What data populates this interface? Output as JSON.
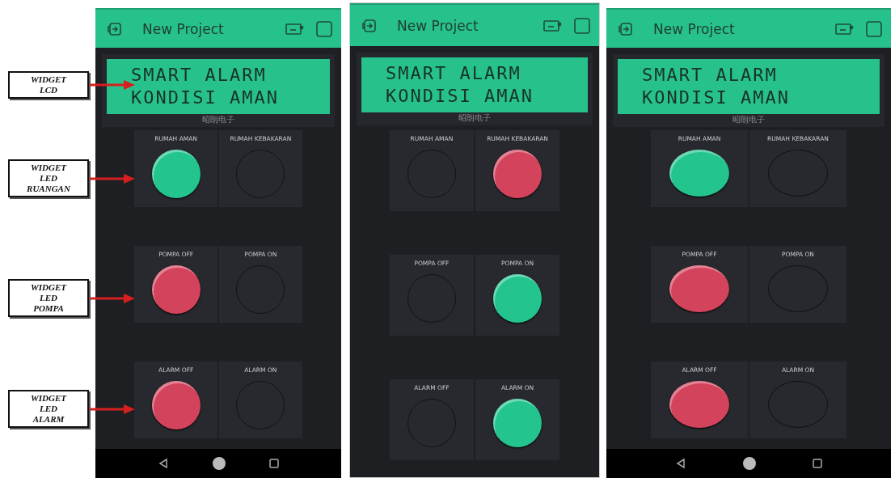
{
  "annotations": [
    {
      "text": "WIDGET\nLCD"
    },
    {
      "text": "WIDGET\nLED\nRUANGAN"
    },
    {
      "text": "WIDGET\nLED\nPOMPA"
    },
    {
      "text": "WIDGET\nLED\nALARM"
    }
  ],
  "phones": [
    {
      "title": "New Project",
      "lcd": [
        "SMART ALARM",
        "KONDISI AMAN"
      ],
      "caption": "昭朗电子",
      "nav_bar": true,
      "led_groups": [
        [
          {
            "label": "RUMAH AMAN",
            "on": true,
            "color": "#23c48e"
          },
          {
            "label": "RUMAH KEBAKARAN",
            "on": false
          }
        ],
        [
          {
            "label": "POMPA OFF",
            "on": true,
            "color": "#d3435c"
          },
          {
            "label": "POMPA ON",
            "on": false
          }
        ],
        [
          {
            "label": "ALARM OFF",
            "on": true,
            "color": "#d3435c"
          },
          {
            "label": "ALARM ON",
            "on": false
          }
        ]
      ]
    },
    {
      "title": "New Project",
      "lcd": [
        "SMART ALARM",
        "KONDISI AMAN"
      ],
      "caption": "昭朗电子",
      "nav_bar": false,
      "led_groups": [
        [
          {
            "label": "RUMAH AMAN",
            "on": false
          },
          {
            "label": "RUMAH KEBAKARAN",
            "on": true,
            "color": "#d3435c"
          }
        ],
        [
          {
            "label": "POMPA OFF",
            "on": false
          },
          {
            "label": "POMPA ON",
            "on": true,
            "color": "#23c48e"
          }
        ],
        [
          {
            "label": "ALARM OFF",
            "on": false
          },
          {
            "label": "ALARM ON",
            "on": true,
            "color": "#23c48e"
          }
        ]
      ]
    },
    {
      "title": "New Project",
      "lcd": [
        "SMART ALARM",
        "KONDISI AMAN"
      ],
      "caption": "昭朗电子",
      "nav_bar": true,
      "led_groups": [
        [
          {
            "label": "RUMAH AMAN",
            "on": true,
            "color": "#23c48e"
          },
          {
            "label": "RUMAH KEBAKARAN",
            "on": false
          }
        ],
        [
          {
            "label": "POMPA OFF",
            "on": true,
            "color": "#d3435c"
          },
          {
            "label": "POMPA ON",
            "on": false
          }
        ],
        [
          {
            "label": "ALARM OFF",
            "on": true,
            "color": "#d3435c"
          },
          {
            "label": "ALARM ON",
            "on": false
          }
        ]
      ]
    }
  ]
}
